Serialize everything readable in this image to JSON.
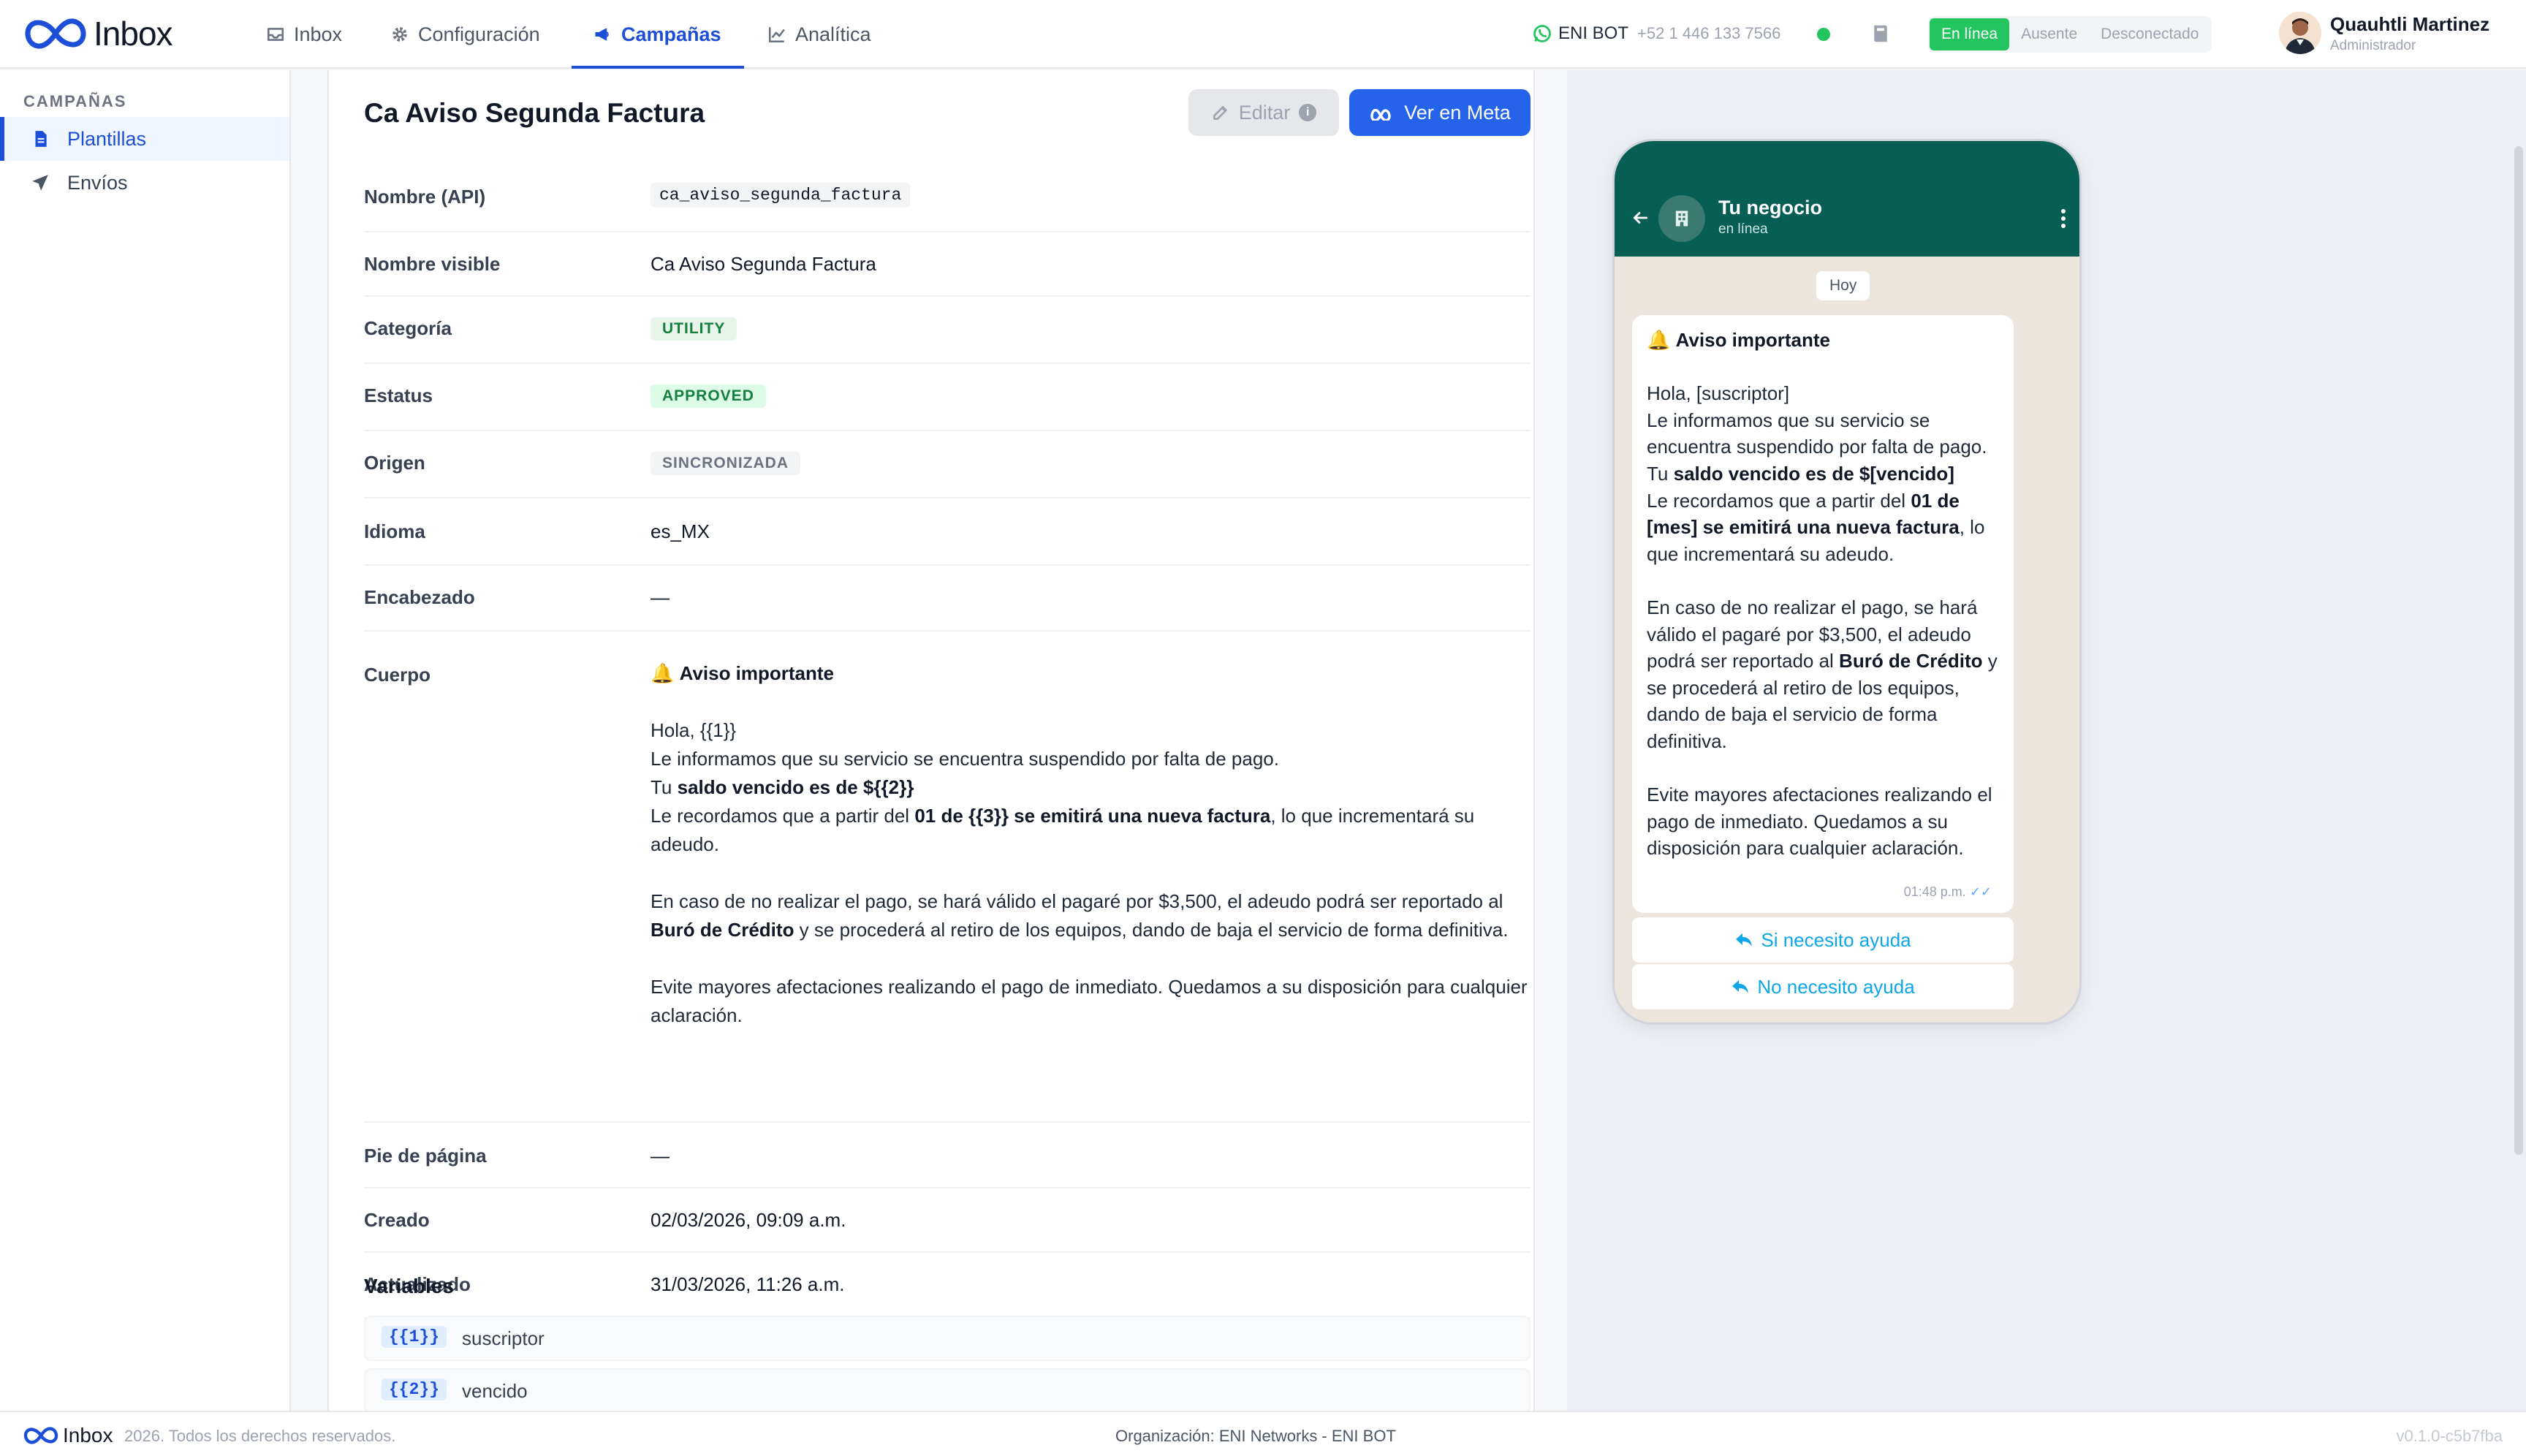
{
  "app": {
    "logo_text": "Inbox",
    "accent": "#1d4ed8",
    "primary_button": "#2563eb",
    "online_color": "#22c55e",
    "whatsapp_header": "#075e54"
  },
  "nav": {
    "inbox": "Inbox",
    "config": "Configuración",
    "campaigns": "Campañas",
    "analytics": "Analítica"
  },
  "status": {
    "bot_name": "ENI BOT",
    "bot_phone": "+52 1 446 133 7566",
    "presence": [
      "En línea",
      "Ausente",
      "Desconectado"
    ],
    "user_name": "Quauhtli Martinez",
    "user_role": "Administrador"
  },
  "sidebar": {
    "heading": "CAMPAÑAS",
    "items": [
      {
        "label": "Plantillas",
        "icon": "document-icon"
      },
      {
        "label": "Envíos",
        "icon": "send-icon"
      }
    ]
  },
  "template": {
    "title": "Ca Aviso Segunda Factura",
    "edit_label": "Editar",
    "meta_label": "Ver en Meta",
    "fields": {
      "api_name_label": "Nombre (API)",
      "api_name": "ca_aviso_segunda_factura",
      "visible_name_label": "Nombre visible",
      "visible_name": "Ca Aviso Segunda Factura",
      "category_label": "Categoría",
      "category": "UTILITY",
      "status_label": "Estatus",
      "status": "APPROVED",
      "origin_label": "Origen",
      "origin": "SINCRONIZADA",
      "language_label": "Idioma",
      "language": "es_MX",
      "header_label": "Encabezado",
      "header": "—",
      "body_label": "Cuerpo",
      "footer_label": "Pie de página",
      "footer": "—",
      "created_label": "Creado",
      "created": "02/03/2026, 09:09 a.m.",
      "updated_label": "Actualizado",
      "updated": "31/03/2026, 11:26 a.m."
    },
    "body": {
      "title": "Aviso importante",
      "greeting": "Hola, {{1}}",
      "line1": "Le informamos que su servicio se encuentra suspendido por falta de pago.",
      "line2_pre": "Tu ",
      "line2_bold": "saldo vencido es de ${{2}}",
      "line3_pre": "Le recordamos que a partir del ",
      "line3_bold": "01 de {{3}} se emitirá una nueva factura",
      "line3_post": ", lo que incrementará su adeudo.",
      "para2_pre": "En caso de no realizar el pago, se hará válido el pagaré por $3,500, el adeudo podrá ser reportado al ",
      "para2_bold": "Buró de Crédito",
      "para2_post": " y se procederá al retiro de los equipos, dando de baja el servicio de forma definitiva.",
      "para3": "Evite mayores afectaciones realizando el pago de inmediato. Quedamos a su disposición para cualquier aclaración."
    },
    "variables_title": "Variables",
    "variables": [
      {
        "key": "{{1}}",
        "value": "suscriptor"
      },
      {
        "key": "{{2}}",
        "value": "vencido"
      }
    ]
  },
  "preview": {
    "contact": "Tu negocio",
    "contact_status": "en línea",
    "day": "Hoy",
    "title": "Aviso importante",
    "greeting": "Hola, [suscriptor]",
    "line1": "Le informamos que su servicio se encuentra suspendido por falta de pago.",
    "line2_pre": "Tu ",
    "line2_bold": "saldo vencido es de $[vencido]",
    "line3_pre": "Le recordamos que a partir del ",
    "line3_bold": "01 de [mes] se emitirá una nueva factura",
    "line3_post": ", lo que incrementará su adeudo.",
    "para2_pre": "En caso de no realizar el pago, se hará válido el pagaré por $3,500, el adeudo podrá ser reportado al ",
    "para2_bold": "Buró de Crédito",
    "para2_post": " y se procederá al retiro de los equipos, dando de baja el servicio de forma definitiva.",
    "para3": "Evite mayores afectaciones realizando el pago de inmediato. Quedamos a su disposición para cualquier aclaración.",
    "time": "01:48 p.m.",
    "buttons": [
      "Si necesito ayuda",
      "No necesito ayuda"
    ]
  },
  "footer": {
    "brand": "Inbox",
    "copyright": "2026. Todos los derechos reservados.",
    "org": "Organización: ENI Networks - ENI BOT",
    "version": "v0.1.0-c5b7fba"
  }
}
